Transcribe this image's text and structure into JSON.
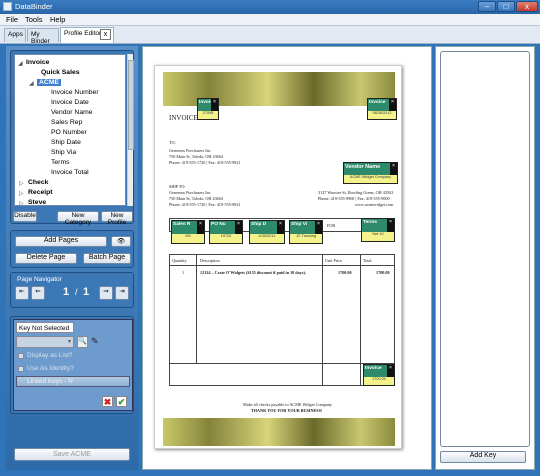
{
  "window": {
    "title": "DataBinder",
    "minimize": "–",
    "maximize": "□",
    "close": "x"
  },
  "menu": [
    "File",
    "Tools",
    "Help"
  ],
  "tabs": [
    {
      "label": "Apps"
    },
    {
      "label": "My Binder"
    },
    {
      "label": "Profile Editor",
      "close": "x"
    }
  ],
  "tree": {
    "items": [
      {
        "label": "Invoice",
        "bold": true
      },
      {
        "label": "Quick Sales"
      },
      {
        "label": "ACME"
      },
      {
        "label": "Invoice Number"
      },
      {
        "label": "Invoice Date"
      },
      {
        "label": "Vendor Name"
      },
      {
        "label": "Sales Rep"
      },
      {
        "label": "PO Number"
      },
      {
        "label": "Ship Date"
      },
      {
        "label": "Ship Via"
      },
      {
        "label": "Terms"
      },
      {
        "label": "Invoice Total"
      },
      {
        "label": "Check",
        "bold": true
      },
      {
        "label": "Receipt",
        "bold": true
      },
      {
        "label": "Steve",
        "bold": true
      }
    ],
    "disable": "Disable",
    "new_category": "New Category",
    "new_profile": "New Profile"
  },
  "pages": {
    "add": "Add Pages",
    "delete": "Delete Page",
    "batch": "Batch Page"
  },
  "navigator": {
    "title": "Page Navigator",
    "current": "1",
    "sep": "/",
    "total": "1"
  },
  "key": {
    "title": "Key Not Selected",
    "display_as_list": "Display as List?",
    "use_as_identity": "Use As Identity?",
    "linked_keys": "Linked Keys - N"
  },
  "save": "Save ACME",
  "add_key": "Add Key",
  "document": {
    "title": "INVOICE",
    "to_label": "TO:",
    "to": [
      "Generous Purchasers Inc",
      "750 Main St, Toledo, OH 43604",
      "Phone: 419-555-1720 | Fax: 419-555-9821"
    ],
    "ship_label": "SHIP TO:",
    "ship": [
      "Generous Purchasers Inc",
      "750 Main St, Toledo, OH 43604",
      "Phone: 419-555-1720 | Fax: 419-555-9821"
    ],
    "vendor_addr": [
      "3127 Wooster St, Bowling Green, OH 43502",
      "Phone: 419-555-9900 | Fax: 419-555-9000",
      "www.acmewidget.com"
    ],
    "for_label": "FOR",
    "col_qty": "Quantity",
    "col_desc": "Description",
    "col_price": "Unit Price",
    "col_total": "Total",
    "line_qty": "1",
    "line_desc": "12124 – Crate O'Widgets ($135 discount if paid in 10 days).",
    "line_price": "1700.00",
    "line_total": "1700.00",
    "footer1": "Make all checks payable to ACME Widget Company",
    "footer2": "THANK YOU FOR YOUR BUSINESS!",
    "fields": {
      "invoice": {
        "label": "Invoice",
        "value": "27095"
      },
      "invoice_date": {
        "label": "Invoice",
        "value": "08/30/2012"
      },
      "vendor": {
        "label": "Vendor Name",
        "value": "ACME Widget Company"
      },
      "sales": {
        "label": "Sales R",
        "value": "M3"
      },
      "po": {
        "label": "PO Nu",
        "value": "19720"
      },
      "ship_date": {
        "label": "Ship D",
        "value": "4/30/2012"
      },
      "ship_via": {
        "label": "Ship Vi",
        "value": "JC Trucking"
      },
      "terms": {
        "label": "Terms",
        "value": "Net 10"
      },
      "total": {
        "label": "Invoice",
        "value": "1700.00"
      }
    }
  }
}
